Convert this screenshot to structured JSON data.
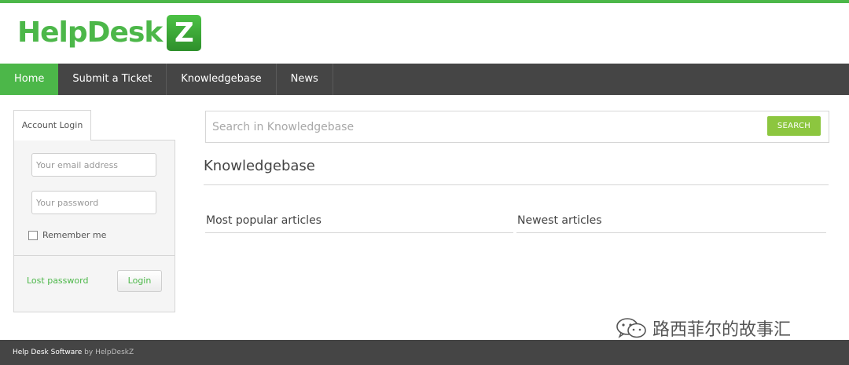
{
  "colors": {
    "brand_green": "#4cb749",
    "nav_bg": "#454545",
    "search_button": "#8cc63f"
  },
  "logo": {
    "text": "HelpDesk",
    "box_letter": "Z"
  },
  "nav": {
    "items": [
      {
        "label": "Home",
        "active": true
      },
      {
        "label": "Submit a Ticket",
        "active": false
      },
      {
        "label": "Knowledgebase",
        "active": false
      },
      {
        "label": "News",
        "active": false
      }
    ]
  },
  "login": {
    "tab_label": "Account Login",
    "email_placeholder": "Your email address",
    "password_placeholder": "Your password",
    "remember_label": "Remember me",
    "remember_checked": false,
    "lost_password_label": "Lost password",
    "login_button_label": "Login"
  },
  "search": {
    "placeholder": "Search in Knowledgebase",
    "button_label": "SEARCH"
  },
  "main": {
    "title": "Knowledgebase",
    "columns": [
      {
        "title": "Most popular articles"
      },
      {
        "title": "Newest articles"
      }
    ]
  },
  "watermark": {
    "text": "路西菲尔的故事汇",
    "icon": "wechat-icon"
  },
  "footer": {
    "product": "Help Desk Software",
    "by": "by",
    "brand": "HelpDeskZ"
  }
}
